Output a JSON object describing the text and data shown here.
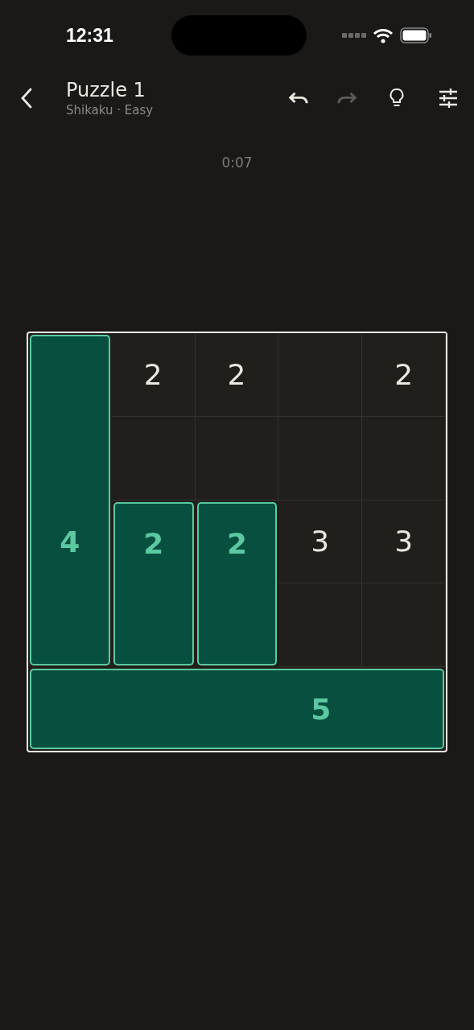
{
  "status_bar": {
    "time": "12:31"
  },
  "header": {
    "title": "Puzzle 1",
    "subtitle": "Shikaku · Easy",
    "actions": [
      {
        "kind": "undo",
        "disabled": false
      },
      {
        "kind": "redo",
        "disabled": true
      },
      {
        "kind": "hint",
        "disabled": false
      },
      {
        "kind": "settings",
        "disabled": false
      }
    ]
  },
  "timer": "0:07",
  "board": {
    "rows": [
      {
        "cells": [
          {
            "shaded": true,
            "joins_right": false,
            "joins_down": true
          },
          {
            "clue": "2",
            "shaded": false
          },
          {
            "clue": "2",
            "shaded": false
          },
          {
            "shaded": false
          },
          {
            "clue": "2",
            "shaded": false
          }
        ]
      },
      {
        "cells": [
          {
            "shaded": true,
            "joins_right": false,
            "joins_down": true
          },
          {
            "shaded": false
          },
          {
            "shaded": false
          },
          {
            "shaded": false
          },
          {
            "shaded": false
          }
        ]
      },
      {
        "cells": [
          {
            "clue": "4",
            "shaded": true,
            "joins_right": false,
            "joins_down": true
          },
          {
            "clue": "2",
            "shaded": true,
            "joins_right": false,
            "joins_down": true
          },
          {
            "clue": "2",
            "shaded": true,
            "joins_right": false,
            "joins_down": true
          },
          {
            "clue": "3",
            "shaded": false
          },
          {
            "clue": "3",
            "shaded": false
          }
        ]
      },
      {
        "cells": [
          {
            "shaded": true,
            "joins_right": false,
            "joins_down": false
          },
          {
            "shaded": true,
            "joins_right": false,
            "joins_down": false
          },
          {
            "shaded": true,
            "joins_right": false,
            "joins_down": false
          },
          {
            "shaded": false
          },
          {
            "shaded": false
          }
        ]
      },
      {
        "cells": [
          {
            "shaded": true,
            "joins_right": true,
            "joins_down": false
          },
          {
            "shaded": true,
            "joins_right": true,
            "joins_down": false
          },
          {
            "shaded": true,
            "joins_right": true,
            "joins_down": false
          },
          {
            "clue": "5",
            "shaded": true,
            "joins_right": true,
            "joins_down": false
          },
          {
            "shaded": true,
            "joins_right": false,
            "joins_down": false
          }
        ]
      }
    ]
  }
}
